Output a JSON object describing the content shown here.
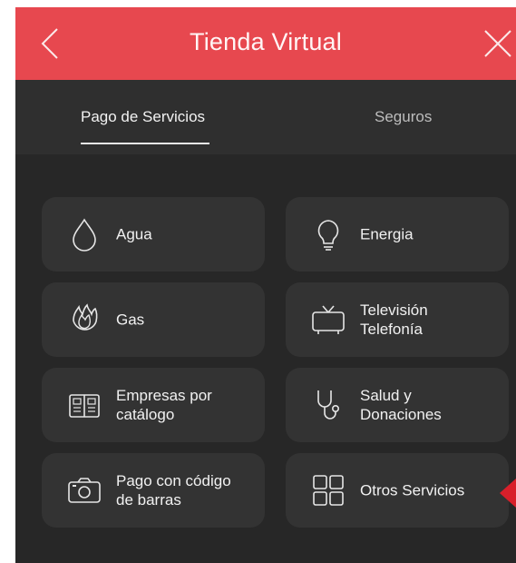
{
  "header": {
    "title": "Tienda Virtual",
    "background_color": "#e7484f",
    "back_icon": "chevron-left-icon",
    "close_icon": "close-icon"
  },
  "tabs": [
    {
      "label": "Pago de Servicios",
      "active": true
    },
    {
      "label": "Seguros",
      "active": false
    }
  ],
  "services": [
    {
      "label": "Agua",
      "icon": "water-drop-icon"
    },
    {
      "label": "Energia",
      "icon": "lightbulb-icon"
    },
    {
      "label": "Gas",
      "icon": "flame-icon"
    },
    {
      "label": "Televisión\nTelefonía",
      "icon": "tv-icon"
    },
    {
      "label": "Empresas por\ncatálogo",
      "icon": "book-icon"
    },
    {
      "label": "Salud y\nDonaciones",
      "icon": "stethoscope-icon"
    },
    {
      "label": "Pago con código\nde barras",
      "icon": "camera-icon"
    },
    {
      "label": "Otros Servicios",
      "icon": "grid-icon"
    }
  ],
  "colors": {
    "screen_background": "#272727",
    "card_background": "#333333",
    "pointer": "#d81f2a"
  }
}
